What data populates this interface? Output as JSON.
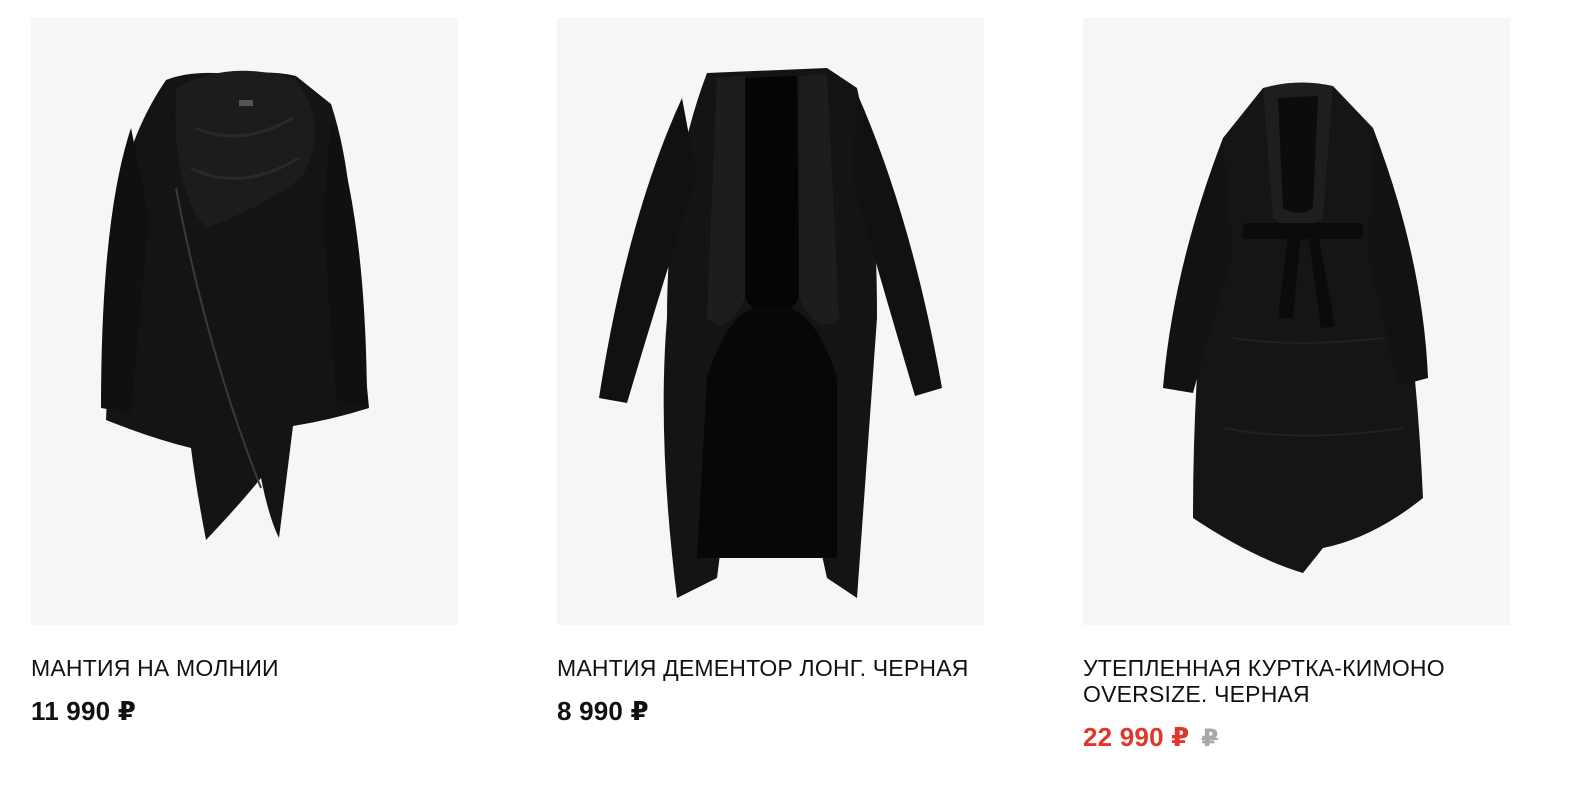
{
  "products": [
    {
      "image_alt": "black-zip-mantle-icon",
      "title": "МАНТИЯ НА МОЛНИИ",
      "price": "11 990 ₽"
    },
    {
      "image_alt": "black-long-mantle-icon",
      "title": "МАНТИЯ ДЕМЕНТОР ЛОНГ. ЧЕРНАЯ",
      "price": "8 990 ₽"
    },
    {
      "image_alt": "black-kimono-jacket-icon",
      "title": "УТЕПЛЕННАЯ КУРТКА-КИМОНО OVERSIZE. ЧЕРНАЯ",
      "price": "22 990 ₽",
      "old_price": "₽",
      "sale_color": "#e0372b"
    }
  ],
  "colors": {
    "image_background": "#f6f6f7",
    "garment": "#141414",
    "text": "#111111",
    "sale_price": "#e0372b",
    "old_price": "#a8a8a8"
  }
}
